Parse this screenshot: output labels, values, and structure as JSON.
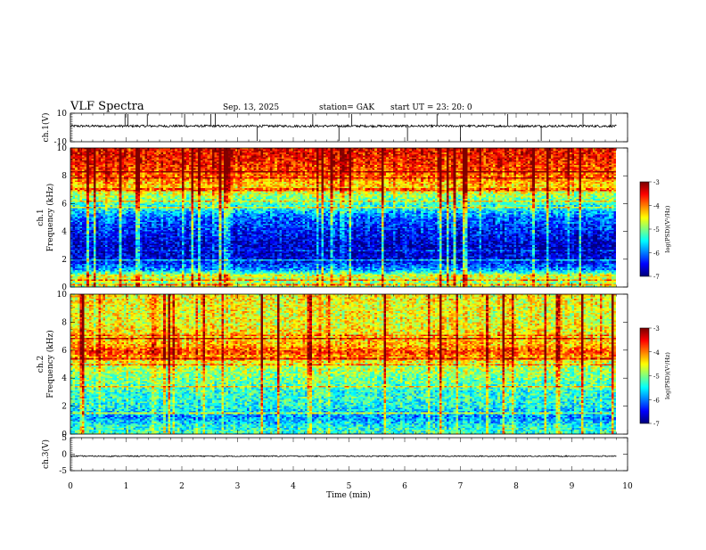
{
  "header": {
    "title": "VLF  Spectra",
    "date": "Sep. 13, 2025",
    "station": "station= GAK",
    "start_ut": "start  UT =   23: 20: 0"
  },
  "chart_data": [
    {
      "type": "line",
      "panel": "ch1-waveform",
      "ylabel": "ch.1(V)",
      "ylim": [
        -10,
        10
      ],
      "yticks": [
        "10",
        "-10"
      ],
      "xlim": [
        0,
        10
      ],
      "baseline": 1.0,
      "spikes_min": [
        0.98,
        1.03,
        1.38,
        2.05,
        2.52,
        2.6,
        3.35,
        4.35,
        4.82,
        5.05,
        6.05,
        6.58,
        7.0,
        7.85,
        8.45,
        9.2,
        9.7
      ],
      "color": "#000000"
    },
    {
      "type": "heatmap",
      "panel": "ch1-spectrogram",
      "ylabel": "ch.1\nFrequency  (kHz)",
      "ylim": [
        0,
        10
      ],
      "yticks": [
        "0",
        "2",
        "4",
        "6",
        "8",
        "10"
      ],
      "xlim": [
        0,
        10
      ],
      "data_end_min": 9.8,
      "colorbar": {
        "label": "log(PSD)(V²/Hz)",
        "ticks": [
          "-3",
          "-4",
          "-5",
          "-6",
          "-7"
        ],
        "range": [
          -7,
          -3
        ]
      },
      "profile": [
        {
          "f": 0.0,
          "v": -5.1
        },
        {
          "f": 0.5,
          "v": -5.0
        },
        {
          "f": 0.8,
          "v": -4.7
        },
        {
          "f": 1.2,
          "v": -6.0
        },
        {
          "f": 2.0,
          "v": -6.8
        },
        {
          "f": 3.0,
          "v": -6.9
        },
        {
          "f": 4.0,
          "v": -6.6
        },
        {
          "f": 5.0,
          "v": -6.3
        },
        {
          "f": 5.6,
          "v": -5.7
        },
        {
          "f": 6.2,
          "v": -5.3
        },
        {
          "f": 7.0,
          "v": -4.7
        },
        {
          "f": 8.0,
          "v": -4.1
        },
        {
          "f": 9.0,
          "v": -3.8
        },
        {
          "f": 10.0,
          "v": -3.7
        }
      ]
    },
    {
      "type": "heatmap",
      "panel": "ch2-spectrogram",
      "ylabel": "ch.2\nFrequency  (kHz)",
      "ylim": [
        0,
        10
      ],
      "yticks": [
        "0",
        "2",
        "4",
        "6",
        "8",
        "10"
      ],
      "xlim": [
        0,
        10
      ],
      "data_end_min": 9.8,
      "colorbar": {
        "label": "log(PSD)(V²/Hz)",
        "ticks": [
          "-3",
          "-4",
          "-5",
          "-6",
          "-7"
        ],
        "range": [
          -7,
          -3
        ]
      },
      "profile": [
        {
          "f": 0.0,
          "v": -5.4
        },
        {
          "f": 0.6,
          "v": -5.6
        },
        {
          "f": 1.2,
          "v": -6.1
        },
        {
          "f": 2.0,
          "v": -5.6
        },
        {
          "f": 3.0,
          "v": -5.5
        },
        {
          "f": 4.0,
          "v": -5.2
        },
        {
          "f": 5.0,
          "v": -4.9
        },
        {
          "f": 5.9,
          "v": -3.9
        },
        {
          "f": 6.3,
          "v": -4.4
        },
        {
          "f": 7.0,
          "v": -4.6
        },
        {
          "f": 8.0,
          "v": -4.8
        },
        {
          "f": 9.0,
          "v": -4.8
        },
        {
          "f": 10.0,
          "v": -4.7
        }
      ]
    },
    {
      "type": "line",
      "panel": "ch3-waveform",
      "ylabel": "ch.3(V)",
      "ylim": [
        -5,
        5
      ],
      "yticks": [
        "5",
        "0",
        "-5"
      ],
      "xlim": [
        0,
        10
      ],
      "baseline": -0.6,
      "spikes_min": [],
      "color": "#000000"
    }
  ],
  "x_axis": {
    "label": "Time  (min)",
    "ticks": [
      "0",
      "1",
      "2",
      "3",
      "4",
      "5",
      "6",
      "7",
      "8",
      "9",
      "10"
    ]
  }
}
